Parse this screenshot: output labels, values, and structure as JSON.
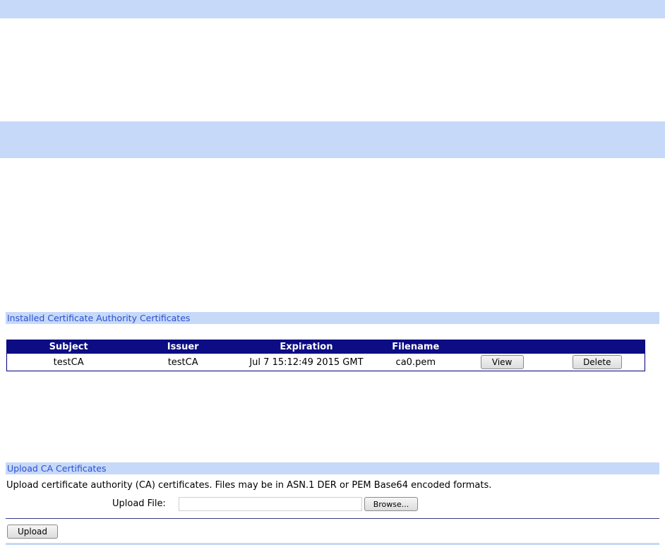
{
  "installed_section": {
    "title": "Installed Certificate Authority Certificates",
    "columns": [
      "Subject",
      "Issuer",
      "Expiration",
      "Filename"
    ],
    "rows": [
      {
        "subject": "testCA",
        "issuer": "testCA",
        "expiration": "Jul 7 15:12:49 2015 GMT",
        "filename": "ca0.pem",
        "view_label": "View",
        "delete_label": "Delete"
      }
    ]
  },
  "upload_section": {
    "title": "Upload CA Certificates",
    "description": "Upload certificate authority (CA) certificates. Files may be in ASN.1 DER or PEM Base64 encoded formats.",
    "file_label": "Upload File:",
    "file_value": "",
    "browse_label": "Browse...",
    "upload_label": "Upload"
  },
  "colors": {
    "band": "#c6d9f9",
    "table_header": "#0c0c84",
    "section_title_text": "#2a4fd0"
  }
}
